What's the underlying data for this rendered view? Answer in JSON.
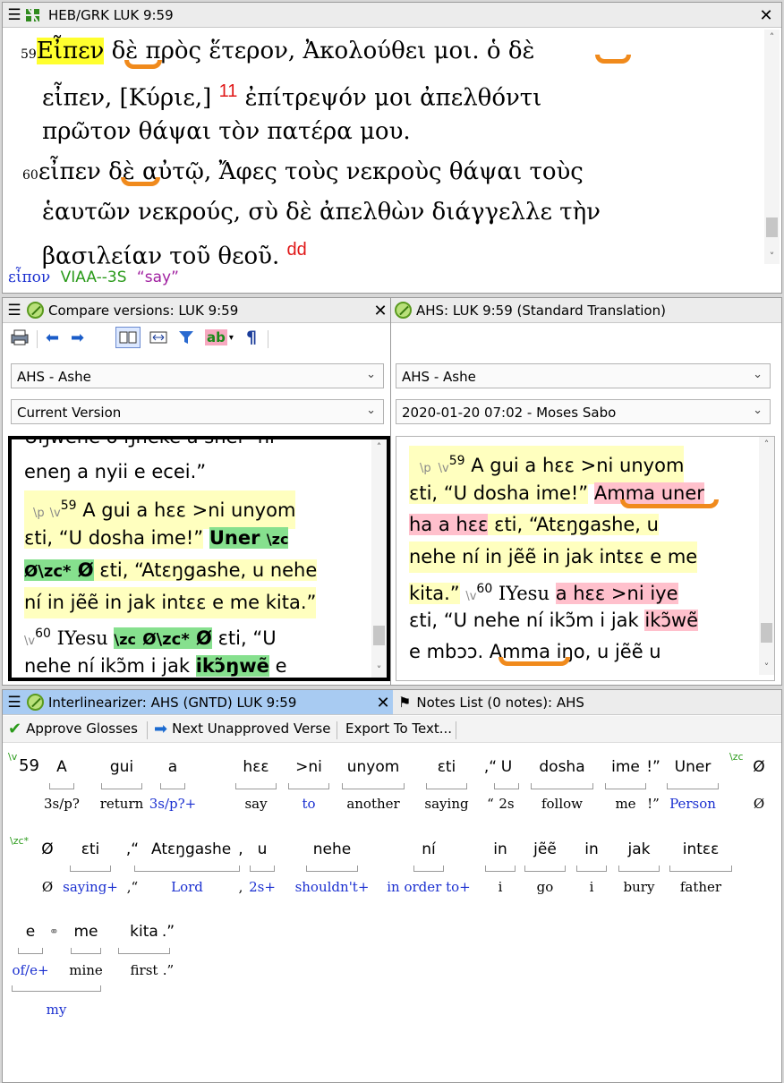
{
  "greek": {
    "title": "HEB/GRK LUK 9:59",
    "v59": "59",
    "v60": "60",
    "l1_word1": "Εἶπεν",
    "l1_rest_a": " δὲ",
    "l1_rest_b": " πρὸς ἕτερον, Ἀκολούθει μοι. ὁ",
    "l1_rest_c": " δὲ",
    "l2_a": "εἶπεν, [Κύριε,]",
    "l2_num": "11",
    "l2_b": " ἐπίτρεψόν μοι ἀπελθόντι",
    "l3": "πρῶτον θάψαι τὸν πατέρα μου.",
    "l4_a": "εἶπεν",
    "l4_b": " δὲ",
    "l4_c": " αὐτῷ, Ἄφες τοὺς νεκροὺς θάψαι τοὺς",
    "l5": "ἑαυτῶν νεκρούς, σὺ δὲ ἀπελθὼν διάγγελλε τὴν",
    "l6_a": "βασιλείαν τοῦ θεοῦ.",
    "l6_b": "dd",
    "status_lemma": "εἶπον",
    "status_parse": "VIAA--3S",
    "status_gloss": "“say”"
  },
  "compare": {
    "title": "Compare versions: LUK 9:59",
    "drop1": "AHS -  Ashe",
    "drop2": "Current Version",
    "ab_label": "ab",
    "pilcrow": "¶",
    "t0": "Uŋwene o ŋneke a snei “ni",
    "t1": "eneŋ a nyii e ecei.”",
    "t2_p": "\\p",
    "t2_v": "\\v",
    "t2_vn": "59",
    "t2_text": " A gui a hεε >ni unyom",
    "t3_a": "εti, “U dosha ime!”",
    "t3_b": "Uner",
    "t3_c": "\\zc",
    "t4_a": "Ø\\zc*",
    "t4_b": "Ø",
    "t4_c": " εti, “Atεŋgashe, u nehe",
    "t5": "ní in jẽẽ in jak intεε e me kita.”",
    "t6_v": "\\v",
    "t6_vn": "60",
    "t6_a": " IYesu",
    "t6_b": "\\zc",
    "t6_c": "Ø\\zc*",
    "t6_d": "Ø",
    "t6_e": " εti, “U",
    "t7_a": "nehe ní ikɔ̃m i jak",
    "t7_b": "ikɔ̃ŋwẽ",
    "t7_c": " e"
  },
  "ahs": {
    "title": "AHS: LUK 9:59 (Standard Translation)",
    "drop1": "AHS -  Ashe",
    "drop2": "2020-01-20 07:02 - Moses Sabo",
    "r1_p": "\\p",
    "r1_v": "\\v",
    "r1_vn": "59",
    "r1_text": " A gui a hεε >ni unyom",
    "r2_a": "εti, “U dosha ime!”",
    "r2_b": "Amma uner",
    "r3_a": "ha a hεε",
    "r3_b": " εti, “Atεŋgashe, u",
    "r4": "nehe ní in jẽẽ in jak intεε e me",
    "r5_a": "kita.”",
    "r5_v": "\\v",
    "r5_vn": "60",
    "r5_b": " IYesu",
    "r5_c": "a hεε >ni iye",
    "r6_a": "εti, “U nehe ní ikɔ̃m i jak",
    "r6_b": "ikɔ̃wẽ",
    "r7": "e mbɔɔ. Amma iŋo, u jẽẽ u"
  },
  "inter": {
    "title": "Interlinearizer: AHS (GNTD) LUK 9:59",
    "approve": "Approve Glosses",
    "next": "Next Unapproved Verse",
    "export": "Export To Text...",
    "vmark": "\\v",
    "vnum": "59",
    "zc": "\\zc",
    "zcs": "\\zc*",
    "row1_tokens": [
      "A",
      "gui",
      "a",
      "hεε",
      ">ni",
      "unyom",
      "εti",
      ",“",
      "U",
      "dosha",
      "ime",
      "!”",
      "Uner",
      "Ø"
    ],
    "row1_gloss": [
      "3s/p?",
      "return",
      "3s/p?+",
      "say",
      "to",
      "another",
      "saying",
      "“",
      "2s",
      "follow",
      "me",
      "!”",
      "Person",
      "Ø"
    ],
    "row2_tokens": [
      "Ø",
      "εti",
      ",“",
      "Atεŋgashe",
      ",",
      "u",
      "nehe",
      "ní",
      "in",
      "jẽẽ",
      "in",
      "jak",
      "intεε"
    ],
    "row2_gloss": [
      "Ø",
      "saying+",
      ",“",
      "Lord",
      ",",
      "2s+",
      "shouldn't+",
      "in order to+",
      "i",
      "go",
      "i",
      "bury",
      "father"
    ],
    "row3_tokens": [
      "e",
      "me",
      "kita",
      ".”"
    ],
    "row3_gloss": [
      "of/e+",
      "mine",
      "first",
      ".”"
    ],
    "row3_extra": "my"
  },
  "notes": {
    "title": "Notes List (0 notes): AHS"
  }
}
